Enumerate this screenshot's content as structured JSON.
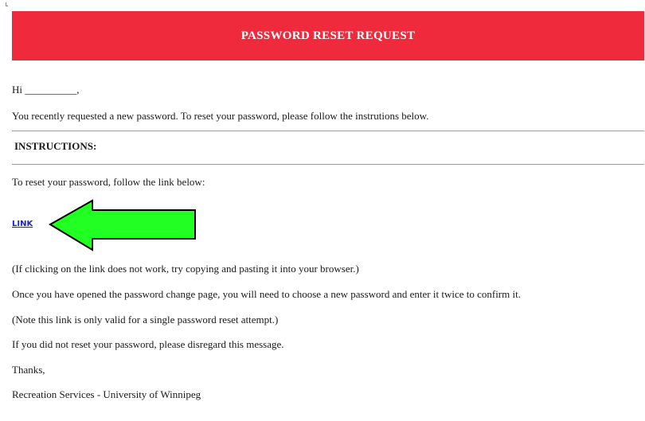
{
  "header": {
    "title": "PASSWORD RESET REQUEST"
  },
  "greeting": "Hi __________,",
  "intro": "You recently requested a new password. To reset your password, please follow the instrutions below.",
  "instructions": {
    "heading": "INSTRUCTIONS:",
    "lead": "To reset your password, follow the link below:",
    "link_label": "LINK",
    "arrow_icon": "green-arrow-left-icon",
    "arrow_color": "#22ff22"
  },
  "body_lines": {
    "fallback": "(If clicking on the link does not work, try copying and pasting it into your browser.)",
    "change_page": "Once you have opened the password change page, you will need to choose a new password and enter it twice to confirm it.",
    "validity": "(Note this link is only valid for a single password reset attempt.)",
    "disregard": "If you did not reset your password, please disregard this message.",
    "thanks": "Thanks,",
    "signature": "Recreation Services - University of Winnipeg"
  },
  "colors": {
    "header_bg": "#ee2a3c",
    "link": "#1d23c9"
  }
}
